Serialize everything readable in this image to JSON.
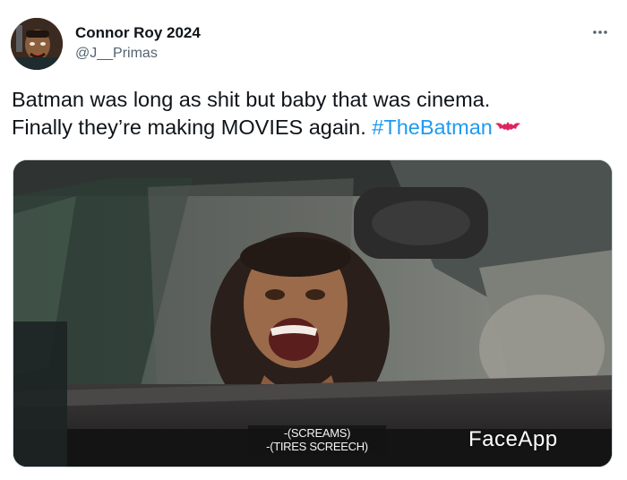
{
  "author": {
    "display_name": "Connor Roy 2024",
    "handle": "@J__Primas"
  },
  "tweet": {
    "line1": "Batman was long as shit but baby that was cinema.",
    "line2_prefix": "Finally they’re making MOVIES again. ",
    "hashtag": "#TheBatman",
    "hashtag_emoji": "bat-emoji"
  },
  "media": {
    "subtitle_line1": "-(SCREAMS)",
    "subtitle_line2": "-(TIRES SCREECH)",
    "watermark": "FaceApp"
  },
  "icons": {
    "more": "more-horizontal-icon"
  },
  "colors": {
    "hashtag": "#1d9bf0",
    "handle": "#536471",
    "bat_emoji": "#e0245e"
  }
}
